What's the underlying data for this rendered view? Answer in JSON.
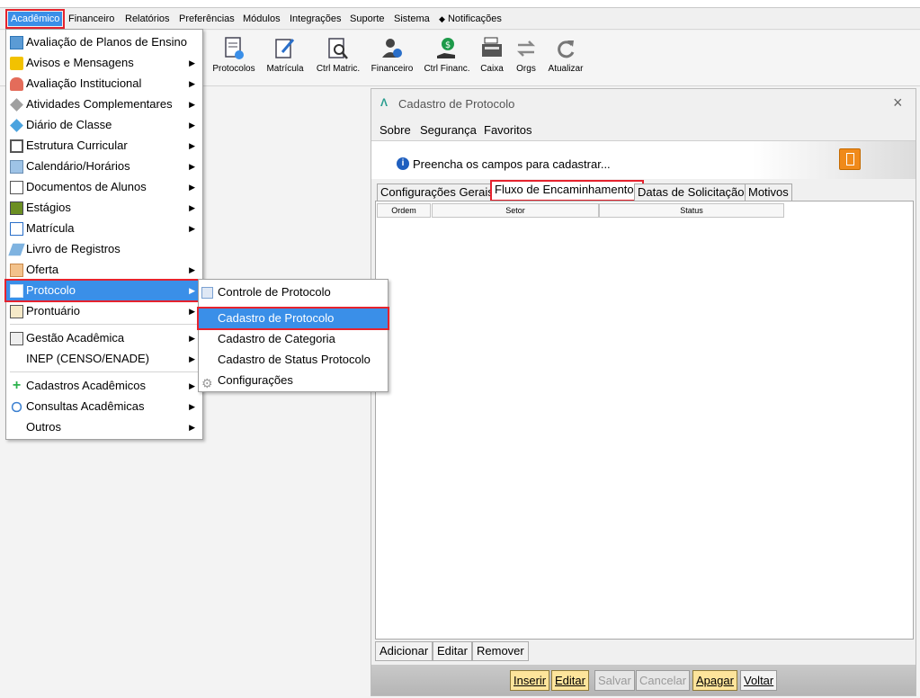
{
  "menubar": {
    "items": [
      {
        "label": "Acadêmico"
      },
      {
        "label": "Financeiro"
      },
      {
        "label": "Relatórios"
      },
      {
        "label": "Preferências"
      },
      {
        "label": "Módulos"
      },
      {
        "label": "Integrações"
      },
      {
        "label": "Suporte"
      },
      {
        "label": "Sistema"
      },
      {
        "label": "Notificações"
      }
    ]
  },
  "toolbar": {
    "items": [
      {
        "label": "Protocolos",
        "icon": "protocol-document-icon"
      },
      {
        "label": "Matrícula",
        "icon": "enrollment-edit-icon"
      },
      {
        "label": "Ctrl Matric.",
        "icon": "enrollment-search-icon"
      },
      {
        "label": "Financeiro",
        "icon": "finance-person-icon"
      },
      {
        "label": "Ctrl Financ.",
        "icon": "finance-hand-icon"
      },
      {
        "label": "Caixa",
        "icon": "cash-register-icon"
      },
      {
        "label": "Orgs",
        "icon": "swap-arrows-icon"
      },
      {
        "label": "Atualizar",
        "icon": "refresh-icon"
      }
    ]
  },
  "academic_menu": {
    "items": [
      {
        "label": "Avaliação de Planos de Ensino",
        "submenu": false
      },
      {
        "label": "Avisos e Mensagens",
        "submenu": true
      },
      {
        "label": "Avaliação Institucional",
        "submenu": true
      },
      {
        "label": "Atividades Complementares",
        "submenu": true
      },
      {
        "label": "Diário de Classe",
        "submenu": true
      },
      {
        "label": "Estrutura Curricular",
        "submenu": true
      },
      {
        "label": "Calendário/Horários",
        "submenu": true
      },
      {
        "label": "Documentos de Alunos",
        "submenu": true
      },
      {
        "label": "Estágios",
        "submenu": true
      },
      {
        "label": "Matrícula",
        "submenu": true
      },
      {
        "label": "Livro de Registros",
        "submenu": false
      },
      {
        "label": "Oferta",
        "submenu": true
      },
      {
        "label": "Protocolo",
        "submenu": true,
        "selected": true
      },
      {
        "label": "Prontuário",
        "submenu": true
      },
      {
        "label": "Gestão Acadêmica",
        "submenu": true
      },
      {
        "label": "INEP (CENSO/ENADE)",
        "submenu": true
      },
      {
        "label": "Cadastros Acadêmicos",
        "submenu": true
      },
      {
        "label": "Consultas Acadêmicas",
        "submenu": true
      },
      {
        "label": "Outros",
        "submenu": true
      }
    ]
  },
  "protocol_submenu": {
    "items": [
      {
        "label": "Controle de Protocolo"
      },
      {
        "label": "Cadastro de Protocolo",
        "selected": true
      },
      {
        "label": "Cadastro de Categoria"
      },
      {
        "label": "Cadastro de Status Protocolo"
      },
      {
        "label": "Configurações"
      }
    ]
  },
  "window": {
    "title": "Cadastro de Protocolo",
    "menu": [
      "Sobre",
      "Segurança",
      "Favoritos"
    ],
    "info_text": "Preencha os campos para cadastrar...",
    "tabs": [
      {
        "label": "Configurações Gerais"
      },
      {
        "label": "Fluxo de Encaminhamentos",
        "active": true
      },
      {
        "label": "Datas de Solicitação"
      },
      {
        "label": "Motivos"
      }
    ],
    "table_headers": [
      "Ordem",
      "Setor",
      "Status"
    ],
    "panel_buttons": [
      "Adicionar",
      "Editar",
      "Remover"
    ],
    "footer_buttons": [
      {
        "label": "Inserir",
        "state": "enabled"
      },
      {
        "label": "Editar",
        "state": "enabled"
      },
      {
        "label": "Salvar",
        "state": "disabled"
      },
      {
        "label": "Cancelar",
        "state": "disabled"
      },
      {
        "label": "Apagar",
        "state": "enabled"
      },
      {
        "label": "Voltar",
        "state": "normal"
      }
    ]
  },
  "colors": {
    "selection": "#3a8fe8",
    "highlight_border": "#e5232e",
    "footer_button": "#fde49b"
  }
}
